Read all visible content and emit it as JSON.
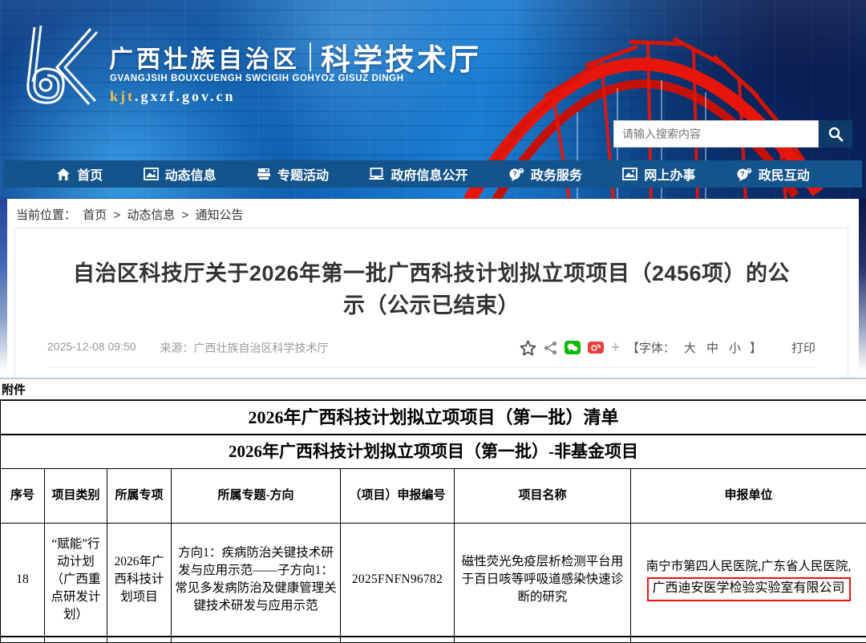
{
  "header": {
    "region_name": "广西壮族自治区",
    "dept_name": "科学技术厅",
    "zhuang_name": "GVANGJSIH BOUXCUENGH SWCIGIH GOHYOZ GISUZ DINGH",
    "url_kjt": "kjt",
    "url_rest": ".gxzf.gov.cn",
    "search_placeholder": "请输入搜索内容"
  },
  "nav": {
    "items": [
      {
        "label": "首页",
        "icon": "home-icon"
      },
      {
        "label": "动态信息",
        "icon": "image-icon"
      },
      {
        "label": "专题活动",
        "icon": "printer-icon"
      },
      {
        "label": "政府信息公开",
        "icon": "monitor-icon"
      },
      {
        "label": "政务服务",
        "icon": "chat-question-icon"
      },
      {
        "label": "网上办事",
        "icon": "image-icon"
      },
      {
        "label": "政民互动",
        "icon": "chat-question-icon"
      }
    ]
  },
  "breadcrumb": {
    "label": "当前位置：",
    "items": [
      "首页",
      "动态信息",
      "通知公告"
    ],
    "separator": ">"
  },
  "article": {
    "title": "自治区科技厅关于2026年第一批广西科技计划拟立项项目（2456项）的公示（公示已结束）",
    "date": "2025-12-08 09:50",
    "source": "来源：广西壮族自治区科学技术厅",
    "font_label_open": "【字体：",
    "font_sizes": [
      "大",
      "中",
      "小"
    ],
    "font_label_close": "】",
    "plus": "+",
    "print_label": "打印"
  },
  "attachment": {
    "label": "附件",
    "table_title": "2026年广西科技计划拟立项项目（第一批）清单",
    "table_subtitle": "2026年广西科技计划拟立项项目（第一批）-非基金项目",
    "columns": [
      "序号",
      "项目类别",
      "所属专项",
      "所属专题-方向",
      "（项目）申报编号",
      "项目名称",
      "申报单位"
    ],
    "row": {
      "seq": "18",
      "category": "“赋能”行动计划（广西重点研发计划）",
      "special_project": "2026年广西科技计划项目",
      "topic_direction": "方向1：疾病防治关键技术研发与应用示范——子方向1：常见多发病防治及健康管理关键技术研发与应用示范",
      "application_no": "2025FNFN96782",
      "project_name": "磁性荧光免疫层析检测平台用于百日咳等呼吸道感染快速诊断的研究",
      "applicant_line1": "南宁市第四人民医院,广东省人民医院,",
      "applicant_highlighted": "广西迪安医学检验实验室有限公司"
    }
  },
  "colors": {
    "nav_blue": "#14548c",
    "search_btn_blue": "#0d3a68",
    "bridge_red": "#e8150b",
    "wechat_green": "#09bb07",
    "weibo_red": "#e6403c",
    "highlight_red": "#f01010"
  }
}
